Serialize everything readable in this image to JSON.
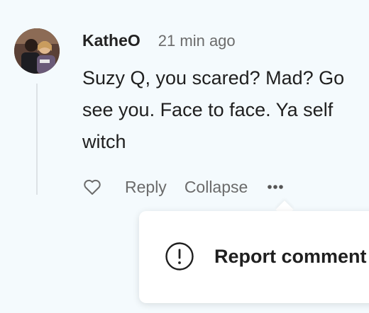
{
  "comment": {
    "author": "KatheO",
    "time": "21 min ago",
    "lines": [
      "Suzy Q, you scared? Mad? Go",
      "see you. Face to face. Ya self",
      "witch"
    ]
  },
  "actions": {
    "like_icon": "heart-icon",
    "reply_label": "Reply",
    "collapse_label": "Collapse",
    "more_icon": "ellipsis-icon"
  },
  "menu": {
    "report_icon": "alert-circle-icon",
    "report_label": "Report comment"
  },
  "colors": {
    "background": "#f4fafd",
    "text": "#1f1f1f",
    "muted": "#6b6b6b",
    "thread_line": "#dde2e6"
  }
}
